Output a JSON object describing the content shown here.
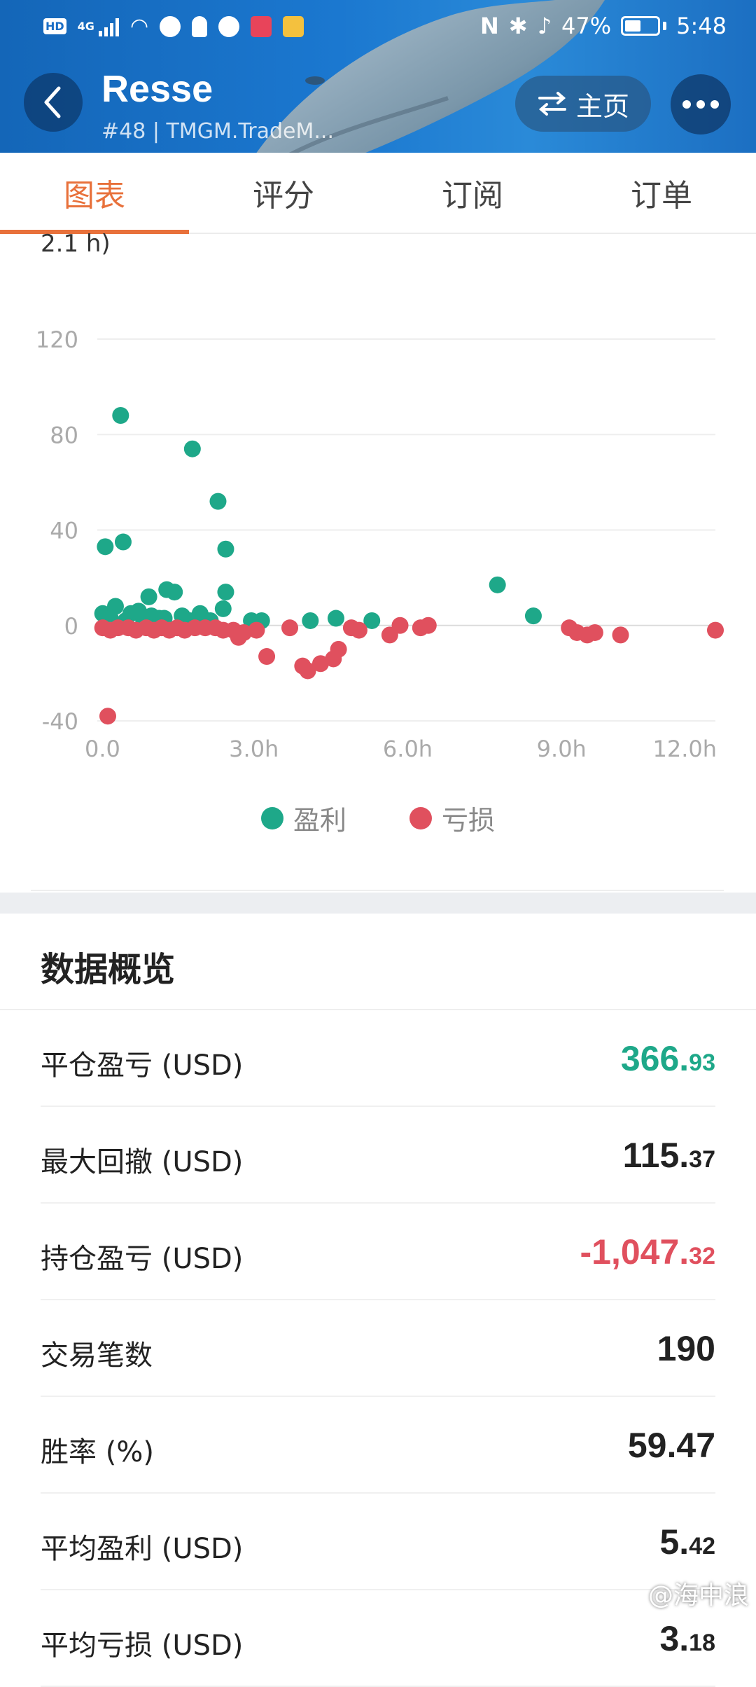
{
  "status_bar": {
    "network": "4G",
    "hd": "HD",
    "battery": "47%",
    "time": "5:48"
  },
  "header": {
    "title": "Resse",
    "subtitle": "#48 | TMGM.TradeM...",
    "home_label": "主页"
  },
  "tabs": [
    "图表",
    "评分",
    "订阅",
    "订单"
  ],
  "chart_top_label": "2.1 h)",
  "chart_data": {
    "type": "scatter",
    "xlabel": "",
    "ylabel": "",
    "x_ticks": [
      "0.0",
      "3.0h",
      "6.0h",
      "9.0h",
      "12.0h"
    ],
    "y_ticks": [
      "120",
      "80",
      "40",
      "0",
      "-40"
    ],
    "xlim": [
      0,
      12
    ],
    "ylim": [
      -40,
      120
    ],
    "grid": true,
    "legend_position": "bottom",
    "series": [
      {
        "name": "盈利",
        "color": "#1ea889",
        "points": [
          [
            0.4,
            88
          ],
          [
            1.8,
            74
          ],
          [
            2.3,
            52
          ],
          [
            0.1,
            33
          ],
          [
            0.45,
            35
          ],
          [
            2.45,
            32
          ],
          [
            1.3,
            15
          ],
          [
            1.45,
            14
          ],
          [
            2.45,
            14
          ],
          [
            0.95,
            12
          ],
          [
            0.3,
            8
          ],
          [
            2.4,
            7
          ],
          [
            0.05,
            5
          ],
          [
            0.6,
            5
          ],
          [
            0.75,
            6
          ],
          [
            1.0,
            4
          ],
          [
            1.15,
            3
          ],
          [
            1.6,
            4
          ],
          [
            1.95,
            5
          ],
          [
            2.0,
            3
          ],
          [
            2.95,
            2
          ],
          [
            3.15,
            2
          ],
          [
            4.1,
            2
          ],
          [
            4.6,
            3
          ],
          [
            5.3,
            2
          ],
          [
            7.75,
            17
          ],
          [
            8.45,
            4
          ],
          [
            0.2,
            3
          ],
          [
            0.5,
            2
          ],
          [
            0.85,
            2
          ],
          [
            1.25,
            3
          ],
          [
            1.75,
            2
          ],
          [
            2.15,
            2
          ]
        ]
      },
      {
        "name": "亏损",
        "color": "#e0505e",
        "points": [
          [
            0.15,
            -38
          ],
          [
            0.05,
            -1
          ],
          [
            0.2,
            -2
          ],
          [
            0.35,
            -1
          ],
          [
            0.55,
            -1
          ],
          [
            0.7,
            -2
          ],
          [
            0.9,
            -1
          ],
          [
            1.05,
            -2
          ],
          [
            1.2,
            -1
          ],
          [
            1.35,
            -2
          ],
          [
            1.5,
            -1
          ],
          [
            1.65,
            -2
          ],
          [
            1.85,
            -1
          ],
          [
            2.05,
            -1
          ],
          [
            2.25,
            -1
          ],
          [
            2.4,
            -2
          ],
          [
            2.6,
            -2
          ],
          [
            2.7,
            -5
          ],
          [
            2.8,
            -3
          ],
          [
            3.05,
            -2
          ],
          [
            3.25,
            -13
          ],
          [
            3.7,
            -1
          ],
          [
            3.95,
            -17
          ],
          [
            4.05,
            -19
          ],
          [
            4.3,
            -16
          ],
          [
            4.55,
            -14
          ],
          [
            4.65,
            -10
          ],
          [
            4.9,
            -1
          ],
          [
            5.05,
            -2
          ],
          [
            5.65,
            -4
          ],
          [
            5.85,
            0
          ],
          [
            6.25,
            -1
          ],
          [
            6.4,
            0
          ],
          [
            9.15,
            -1
          ],
          [
            9.3,
            -3
          ],
          [
            9.5,
            -4
          ],
          [
            9.65,
            -3
          ],
          [
            10.15,
            -4
          ],
          [
            12.0,
            -2
          ]
        ]
      }
    ]
  },
  "overview": {
    "title": "数据概览",
    "rows": [
      {
        "label": "平仓盈亏 (USD)",
        "int": "366.",
        "dec": "93",
        "tone": "green"
      },
      {
        "label": "最大回撤 (USD)",
        "int": "115.",
        "dec": "37",
        "tone": "normal"
      },
      {
        "label": "持仓盈亏 (USD)",
        "int": "-1,047.",
        "dec": "32",
        "tone": "red"
      },
      {
        "label": "交易笔数",
        "int": "190",
        "dec": "",
        "tone": "normal"
      },
      {
        "label": "胜率 (%)",
        "int": "59.47",
        "dec": "",
        "tone": "normal"
      },
      {
        "label": "平均盈利 (USD)",
        "int": "5.",
        "dec": "42",
        "tone": "normal"
      },
      {
        "label": "平均亏损 (USD)",
        "int": "3.",
        "dec": "18",
        "tone": "normal"
      }
    ]
  },
  "watermark": "@海中浪"
}
